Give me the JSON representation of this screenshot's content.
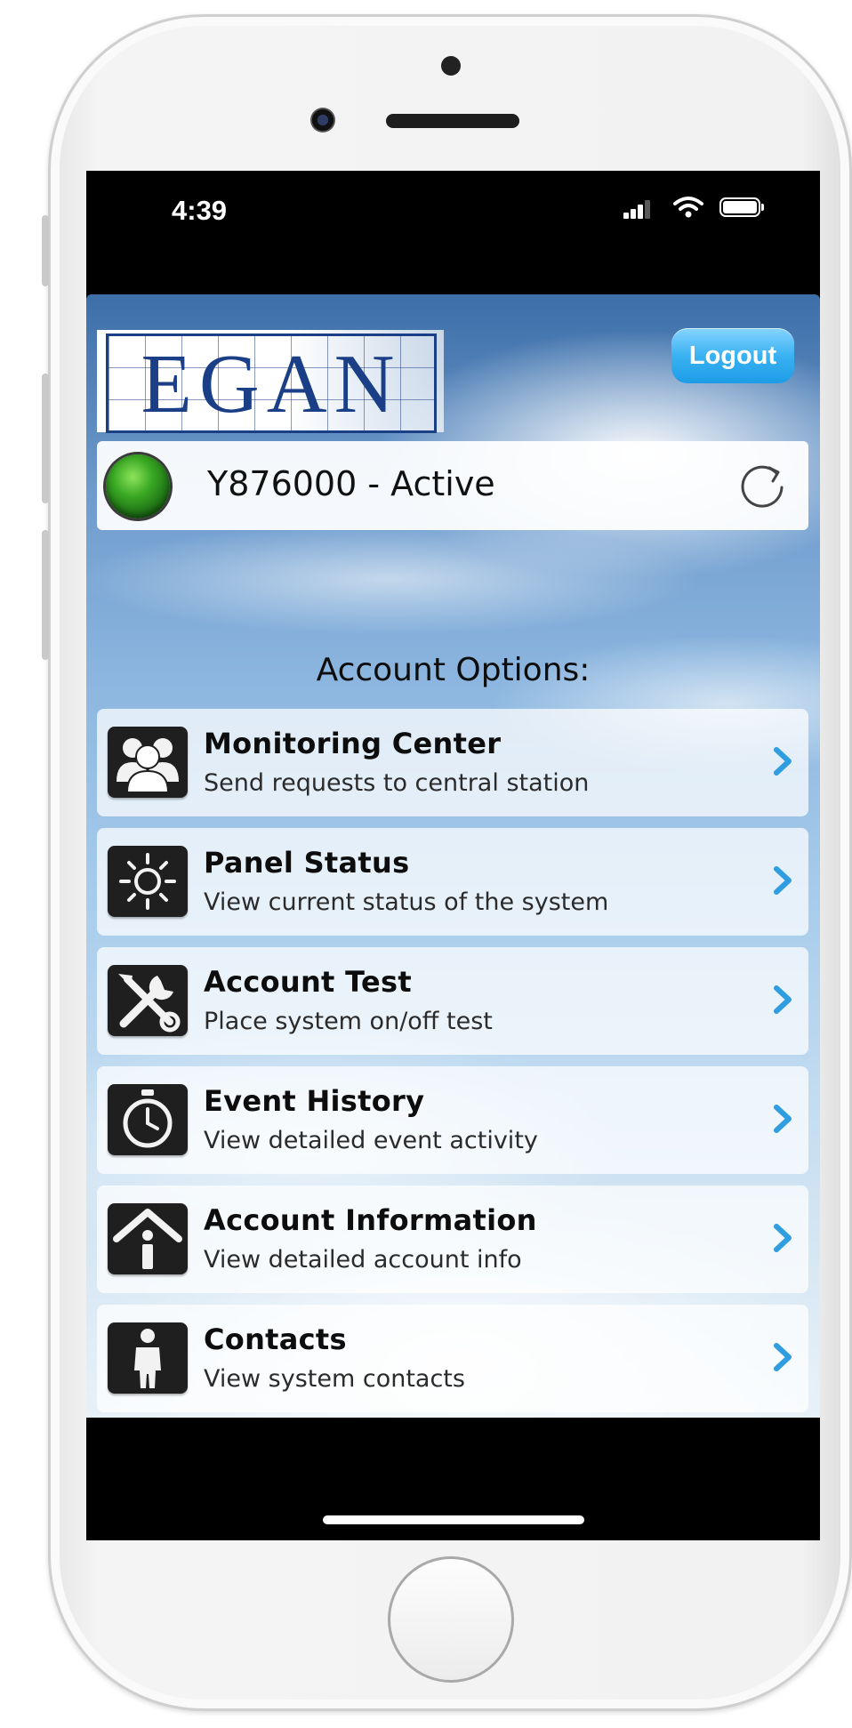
{
  "status_bar": {
    "time": "4:39",
    "icons": [
      "signal-icon",
      "wifi-icon",
      "battery-icon"
    ]
  },
  "header": {
    "logo_text": "EGAN",
    "logout_label": "Logout"
  },
  "account": {
    "status_text": "Y876000 - Active",
    "status_color": "#3aa824"
  },
  "options": {
    "title": "Account Options:",
    "items": [
      {
        "title": "Monitoring Center",
        "subtitle": "Send requests to central station",
        "icon": "people-icon"
      },
      {
        "title": "Panel Status",
        "subtitle": "View current status of the system",
        "icon": "sun-icon"
      },
      {
        "title": "Account Test",
        "subtitle": "Place system on/off test",
        "icon": "tools-icon"
      },
      {
        "title": "Event History",
        "subtitle": "View detailed event activity",
        "icon": "stopwatch-icon"
      },
      {
        "title": "Account Information",
        "subtitle": "View detailed account info",
        "icon": "house-info-icon"
      },
      {
        "title": "Contacts",
        "subtitle": "View system contacts",
        "icon": "person-icon"
      }
    ]
  },
  "colors": {
    "accent": "#1c9ce6",
    "chevron": "#2f9de0",
    "logo_blue": "#1a3f86"
  }
}
